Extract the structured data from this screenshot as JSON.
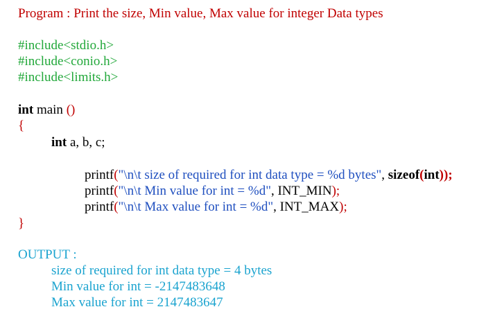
{
  "title": "Program : Print the size, Min value, Max value for integer Data types",
  "includes": [
    "#include<stdio.h>",
    "#include<conio.h>",
    "#include<limits.h>"
  ],
  "main_sig": {
    "kw": "int",
    "name": " main ",
    "parens": "()"
  },
  "open_brace": "{",
  "decl": {
    "kw": "int",
    "vars": " a, b, c;"
  },
  "printf1": {
    "fn": "printf",
    "open": "(",
    "str": "\"\\n\\t size of required for int data type = %d bytes\"",
    "comma": ", ",
    "sizeof_kw": "sizeof",
    "arg_open": "(",
    "arg": "int",
    "arg_close": "))",
    "semi": ";"
  },
  "printf2": {
    "fn": "printf",
    "open": "(",
    "str": "\"\\n\\t Min value for int = %d\"",
    "comma": ", ",
    "arg": "INT_MIN",
    "close": ");"
  },
  "printf3": {
    "fn": "printf",
    "open": "(",
    "str": "\"\\n\\t Max value for int = %d\"",
    "comma": ", ",
    "arg": "INT_MAX",
    "close": ");"
  },
  "close_brace": "}",
  "output": {
    "label": "OUTPUT :",
    "lines": [
      "size of required for int data type = 4 bytes",
      "Min value for int = -2147483648",
      "Max value for int = 2147483647"
    ]
  },
  "colors": {
    "title": "#c00000",
    "include": "#22a83a",
    "keyword": "#000000",
    "brace": "#c00000",
    "string": "#1f4fbf",
    "output": "#1aa3cf"
  }
}
